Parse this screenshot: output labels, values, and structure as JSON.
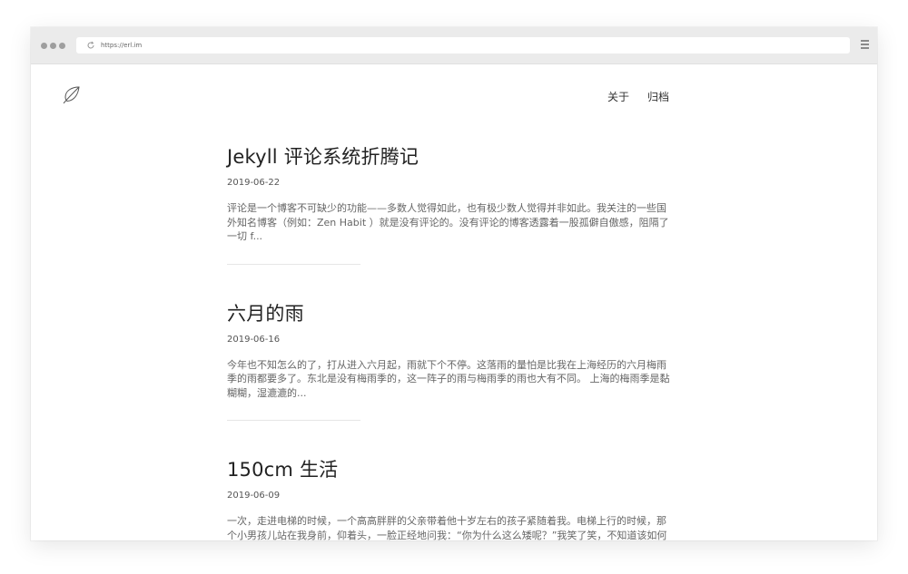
{
  "browser": {
    "url": "https://erl.im"
  },
  "nav": {
    "items": [
      {
        "label": "关于"
      },
      {
        "label": "归档"
      }
    ]
  },
  "posts": [
    {
      "title": "Jekyll 评论系统折腾记",
      "date": "2019-06-22",
      "excerpt": "评论是一个博客不可缺少的功能——多数人觉得如此，也有极少数人觉得并非如此。我关注的一些国外知名博客（例如：Zen Habit ）就是没有评论的。没有评论的博客透露着一股孤僻自傲感，阻隔了一切 f..."
    },
    {
      "title": "六月的雨",
      "date": "2019-06-16",
      "excerpt": "今年也不知怎么的了，打从进入六月起，雨就下个不停。这落雨的量怕是比我在上海经历的六月梅雨季的雨都要多了。东北是没有梅雨季的，这一阵子的雨与梅雨季的雨也大有不同。 上海的梅雨季是黏糊糊，湿漉漉的..."
    },
    {
      "title": "150cm 生活",
      "date": "2019-06-09",
      "excerpt": "一次，走进电梯的时候，一个高高胖胖的父亲带着他十岁左右的孩子紧随着我。电梯上行的时候，那个小男孩儿站在我身前，仰着头，一脸正经地问我：“你为什么这么矮呢？”我笑了笑，不知道该如何作答，便转头看向..."
    }
  ],
  "icons": {
    "logo": "leaf-icon",
    "reload": "reload-icon",
    "menu": "hamburger-menu-icon"
  }
}
